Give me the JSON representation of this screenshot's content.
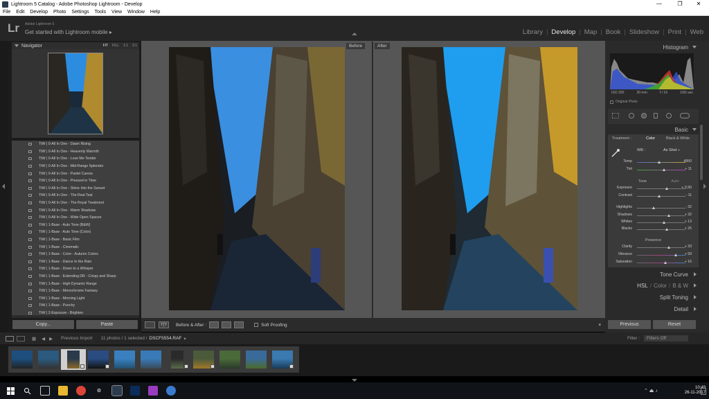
{
  "window": {
    "title": "Lightroom 5 Catalog - Adobe Photoshop Lightroom - Develop",
    "minimize": "—",
    "maximize": "❐",
    "close": "✕"
  },
  "menu": [
    "File",
    "Edit",
    "Develop",
    "Photo",
    "Settings",
    "Tools",
    "View",
    "Window",
    "Help"
  ],
  "lr": {
    "logo": "Lr",
    "product": "Adobe Lightroom 5",
    "mobile": "Get started with Lightroom mobile",
    "modules": [
      "Library",
      "Develop",
      "Map",
      "Book",
      "Slideshow",
      "Print",
      "Web"
    ],
    "active_module": "Develop"
  },
  "navigator": {
    "title": "Navigator",
    "zoom": [
      "FIT",
      "FILL",
      "1:1",
      "3:1"
    ]
  },
  "presets": [
    "TtW | 0-All In One - Dawn Rising",
    "TtW | 0-All In One - Heavenly Warmth",
    "TtW | 0-All In One - Love Me Tender",
    "TtW | 0-All In One - Mid-Range Splendor",
    "TtW | 0-All In One - Pastel Caress",
    "TtW | 0-All In One - Pressed in Time",
    "TtW | 0-All In One - Shine Into the Sunset",
    "TtW | 0-All In One - The Real Teal",
    "TtW | 0-All In One - The Royal Treatment",
    "TtW | 0-All In One - Warm Shadows",
    "TtW | 0-All In One - Wide Open Spaces",
    "TtW | 1-Base - Auto Tone (B&W)",
    "TtW | 1-Base - Auto Tone (Color)",
    "TtW | 1-Base - Basic Film",
    "TtW | 1-Base - Cinematic",
    "TtW | 1-Base - Color - Autumn Colors",
    "TtW | 1-Base - Dance In the Rain",
    "TtW | 1-Base - Down to a Whisper",
    "TtW | 1-Base - Extending DR - Crispy and Sharp",
    "TtW | 1-Base - High Dynamic Range",
    "TtW | 1-Base - Monochrome Fantasy",
    "TtW | 1-Base - Morning Light",
    "TtW | 1-Base - Punchy",
    "TtW | 2-Exposure - Brighten"
  ],
  "left_buttons": {
    "copy": "Copy...",
    "paste": "Paste"
  },
  "compare": {
    "before": "Before",
    "after": "After"
  },
  "toolbar": {
    "view_label": "Y|Y",
    "before_after": "Before & After :",
    "soft_proofing": "Soft Proofing"
  },
  "histogram": {
    "title": "Histogram",
    "info": [
      "ISO 200",
      "30 mm",
      "f / 16",
      "1/60 sec"
    ],
    "original_photo": "Original Photo"
  },
  "basic": {
    "title": "Basic",
    "treatment_label": "Treatment :",
    "treatment_color": "Color",
    "treatment_bw": "Black & White",
    "wb_label": "WB :",
    "wb_value": "As Shot ÷",
    "tone_label": "Tone",
    "auto_label": "Auto",
    "presence_label": "Presence",
    "sliders": [
      {
        "label": "Temp",
        "value": "4950",
        "pos": 0.45
      },
      {
        "label": "Tint",
        "value": "+ 11",
        "pos": 0.55
      },
      {
        "label": "Exposure",
        "value": "+ 0,90",
        "pos": 0.62
      },
      {
        "label": "Contrast",
        "value": "- 11",
        "pos": 0.45
      },
      {
        "label": "Highlights",
        "value": "- 32",
        "pos": 0.34
      },
      {
        "label": "Shadows",
        "value": "+ 32",
        "pos": 0.66
      },
      {
        "label": "Whites",
        "value": "+ 13",
        "pos": 0.56
      },
      {
        "label": "Blacks",
        "value": "+ 25",
        "pos": 0.62
      },
      {
        "label": "Clarity",
        "value": "+ 33",
        "pos": 0.66
      },
      {
        "label": "Vibrance",
        "value": "+ 59",
        "pos": 0.8
      },
      {
        "label": "Saturation",
        "value": "+ 16",
        "pos": 0.58
      }
    ]
  },
  "panels": {
    "tone_curve": "Tone Curve",
    "hsl": "HSL",
    "hsl_slash1": "/",
    "hsl_color": "Color",
    "hsl_slash2": "/",
    "hsl_bw": "B & W",
    "split_toning": "Split Toning",
    "detail": "Detail"
  },
  "right_buttons": {
    "previous": "Previous",
    "reset": "Reset"
  },
  "filmbar": {
    "source": "Previous Import",
    "count": "11 photos / 1 selected /",
    "filename": "DSCF5554.RAF",
    "filter_label": "Filter :",
    "filter_value": "Filters Off"
  },
  "tray": {
    "time": "10:49",
    "date": "26-11-2017"
  },
  "colors": {
    "accent": "#e8e8e8",
    "panel": "#3f3f3f",
    "sky": "#1f8fe0"
  }
}
